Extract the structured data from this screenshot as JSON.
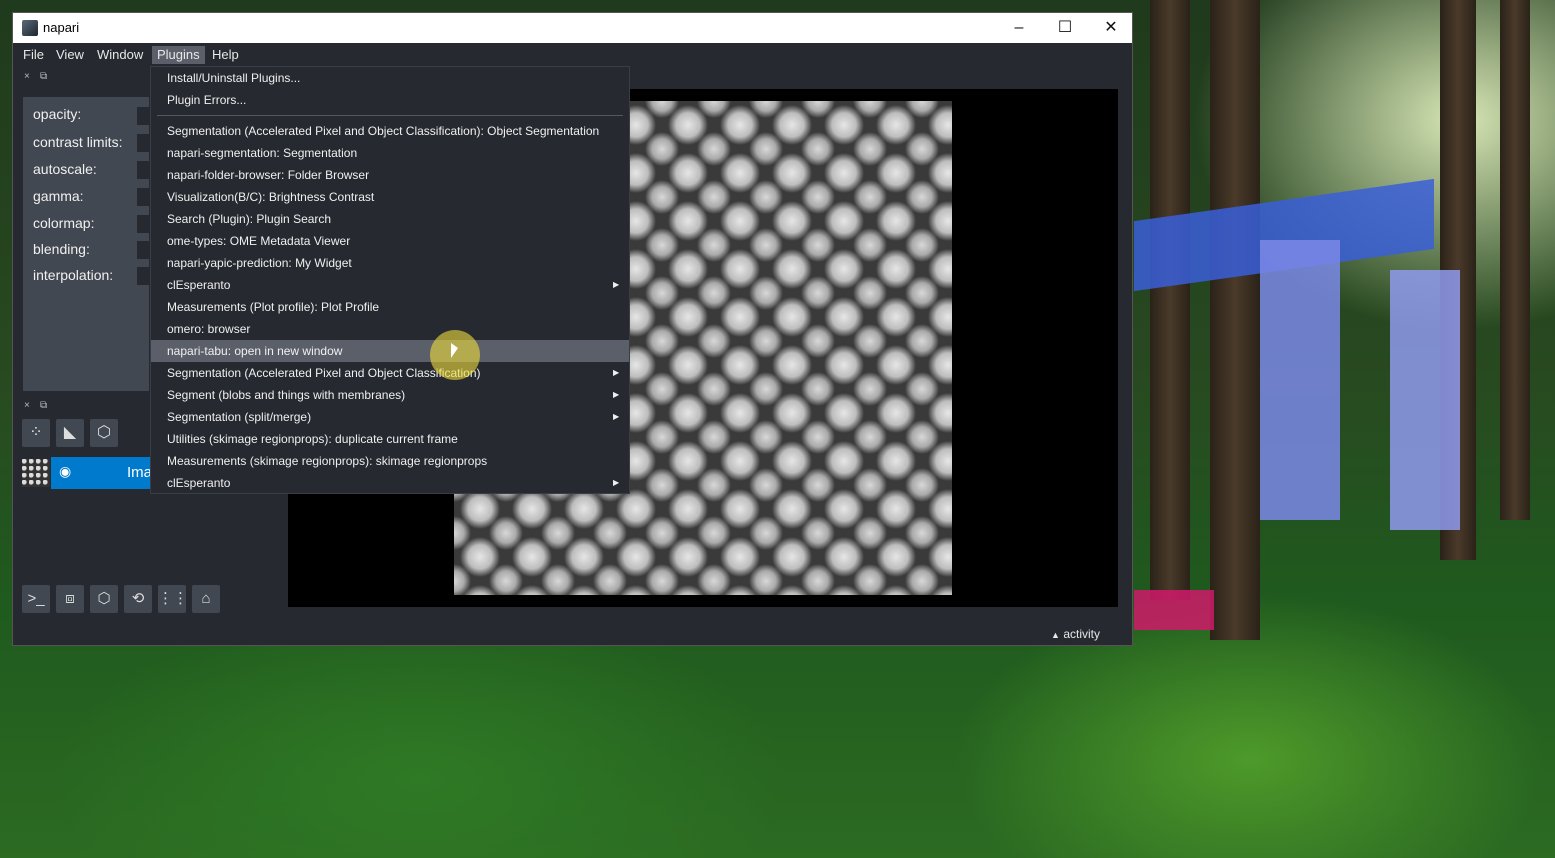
{
  "window": {
    "title": "napari",
    "buttons": {
      "minimize": "–",
      "maximize": "☐",
      "close": "✕"
    }
  },
  "menubar": [
    "File",
    "View",
    "Window",
    "Plugins",
    "Help"
  ],
  "active_menu": "Plugins",
  "dock": {
    "close": "×",
    "float": "⧉"
  },
  "layer_controls": [
    "opacity:",
    "contrast limits:",
    "autoscale:",
    "gamma:",
    "colormap:",
    "blending:",
    "interpolation:"
  ],
  "layer_tools": [
    "⁘",
    "◣",
    "⬡"
  ],
  "layer": {
    "name": "Ima",
    "visibility_icon": "◉"
  },
  "bottom_buttons": [
    {
      "name": "console-icon",
      "glyph": ">_"
    },
    {
      "name": "ndisplay-icon",
      "glyph": "⧈"
    },
    {
      "name": "roll-icon",
      "glyph": "⬡"
    },
    {
      "name": "transpose-icon",
      "glyph": "⟲"
    },
    {
      "name": "grid-icon",
      "glyph": "⋮⋮"
    },
    {
      "name": "home-icon",
      "glyph": "⌂"
    }
  ],
  "status": {
    "activity": "activity",
    "activity_icon": "▲"
  },
  "plugins_menu": {
    "top_items": [
      "Install/Uninstall Plugins...",
      "Plugin Errors..."
    ],
    "items": [
      {
        "label": "Segmentation (Accelerated Pixel and Object Classification): Object Segmentation",
        "submenu": false
      },
      {
        "label": "napari-segmentation: Segmentation",
        "submenu": false
      },
      {
        "label": "napari-folder-browser: Folder Browser",
        "submenu": false
      },
      {
        "label": "Visualization(B/C): Brightness Contrast",
        "submenu": false
      },
      {
        "label": "Search (Plugin): Plugin Search",
        "submenu": false
      },
      {
        "label": "ome-types: OME Metadata Viewer",
        "submenu": false
      },
      {
        "label": "napari-yapic-prediction: My Widget",
        "submenu": false
      },
      {
        "label": "clEsperanto",
        "submenu": true
      },
      {
        "label": "Measurements (Plot profile): Plot Profile",
        "submenu": false
      },
      {
        "label": "omero: browser",
        "submenu": false
      },
      {
        "label": "napari-tabu: open in new window",
        "submenu": false,
        "highlighted": true
      },
      {
        "label": "Segmentation (Accelerated Pixel and Object Classification)",
        "submenu": true
      },
      {
        "label": "Segment (blobs and things with membranes)",
        "submenu": true
      },
      {
        "label": "Segmentation (split/merge)",
        "submenu": true
      },
      {
        "label": "Utilities (skimage regionprops): duplicate current frame",
        "submenu": false
      },
      {
        "label": "Measurements (skimage regionprops): skimage regionprops",
        "submenu": false
      },
      {
        "label": "clEsperanto",
        "submenu": true
      }
    ],
    "submenu_arrow": "▶"
  }
}
